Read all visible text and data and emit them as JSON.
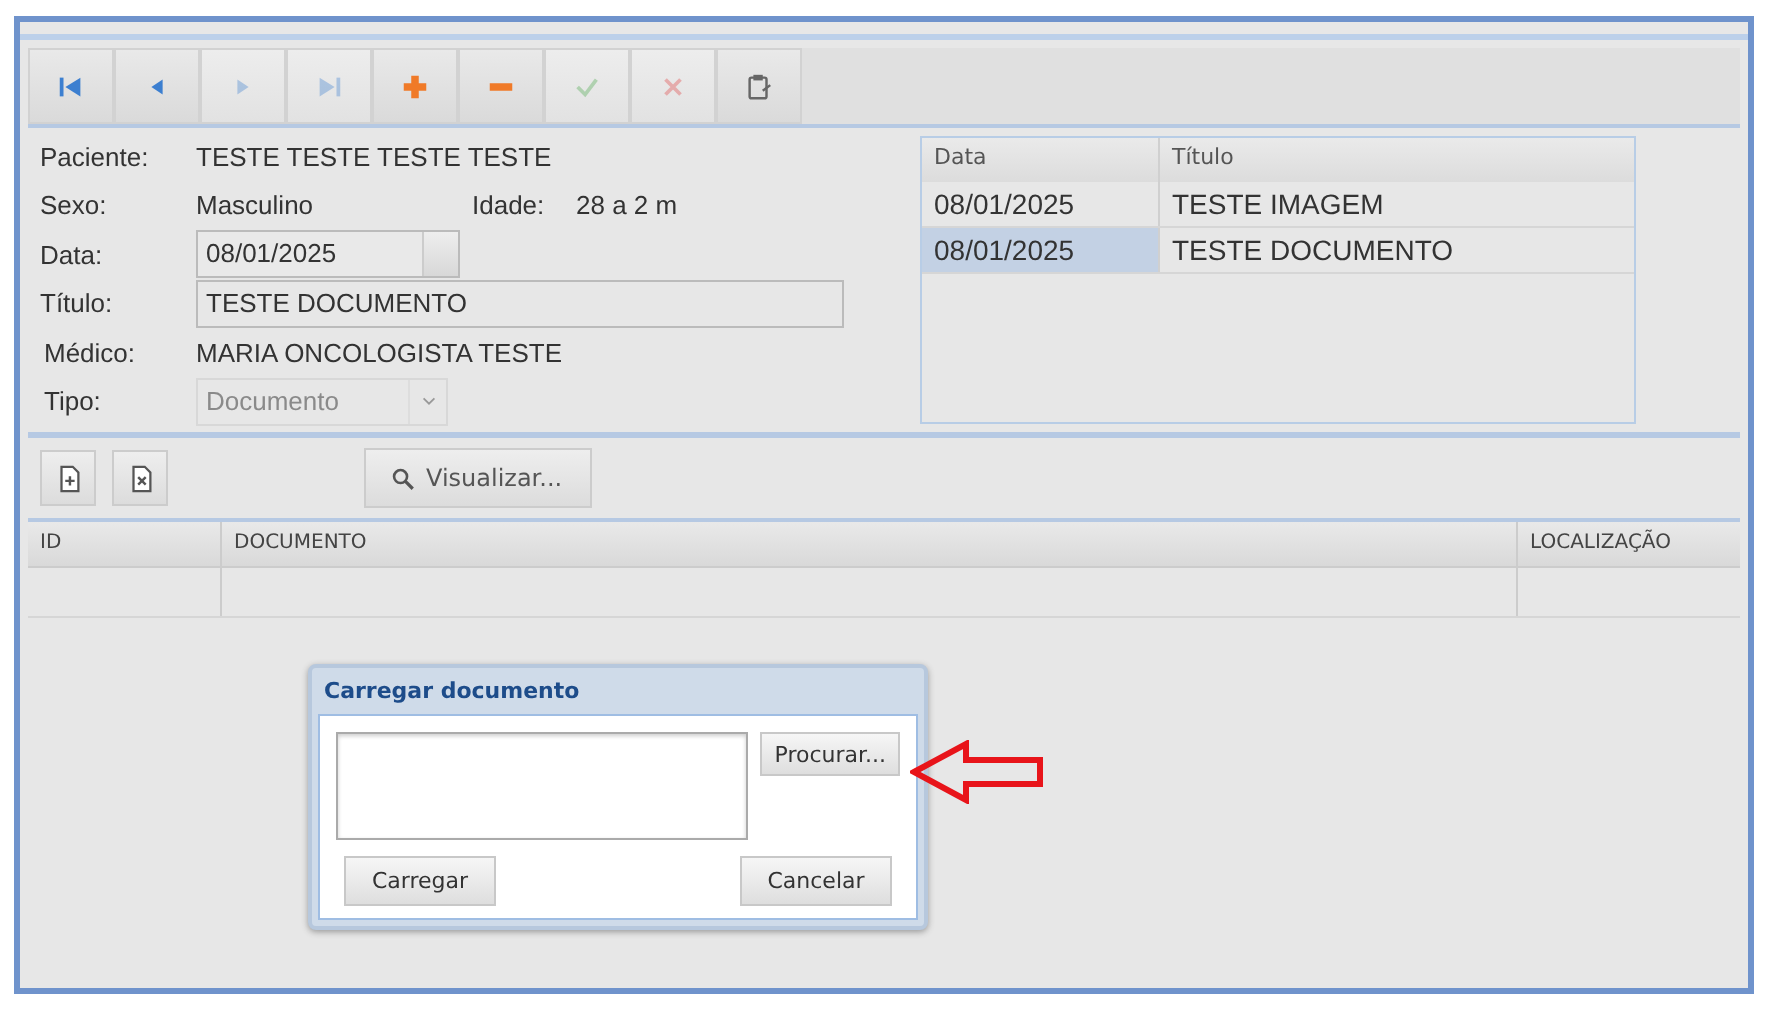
{
  "toolbar": {
    "buttons": [
      {
        "kind": "first",
        "disabled": false
      },
      {
        "kind": "previous",
        "disabled": false
      },
      {
        "kind": "next",
        "disabled": true
      },
      {
        "kind": "last",
        "disabled": true
      },
      {
        "kind": "add",
        "disabled": false
      },
      {
        "kind": "remove",
        "disabled": false
      },
      {
        "kind": "confirm",
        "disabled": true
      },
      {
        "kind": "cancel",
        "disabled": true
      },
      {
        "kind": "clipboard",
        "disabled": false
      }
    ]
  },
  "form": {
    "paciente": {
      "label": "Paciente:",
      "value": "TESTE TESTE TESTE TESTE"
    },
    "sexo": {
      "label": "Sexo:",
      "value": "Masculino"
    },
    "idade": {
      "label": "Idade:",
      "value": "28 a 2 m"
    },
    "data": {
      "label": "Data:",
      "value": "08/01/2025"
    },
    "titulo": {
      "label": "Título:",
      "value": "TESTE DOCUMENTO"
    },
    "medico": {
      "label": "Médico:",
      "value": "MARIA ONCOLOGISTA TESTE"
    },
    "tipo": {
      "label": "Tipo:",
      "value": "Documento",
      "disabled": true
    }
  },
  "records": {
    "columns": [
      "Data",
      "Título"
    ],
    "rows": [
      {
        "cells": [
          "08/01/2025",
          "TESTE IMAGEM"
        ],
        "selected": false
      },
      {
        "cells": [
          "08/01/2025",
          "TESTE DOCUMENTO"
        ],
        "selected": true
      }
    ]
  },
  "doc_toolbar": {
    "buttons": [
      {
        "kind": "file-add"
      },
      {
        "kind": "file-remove"
      }
    ],
    "preview": "Visualizar..."
  },
  "documents": {
    "columns": [
      "ID",
      "DOCUMENTO",
      "LOCALIZAÇÃO"
    ]
  },
  "dialog": {
    "title": "Carregar documento",
    "browse": "Procurar...",
    "upload": "Carregar",
    "cancel": "Cancelar"
  }
}
